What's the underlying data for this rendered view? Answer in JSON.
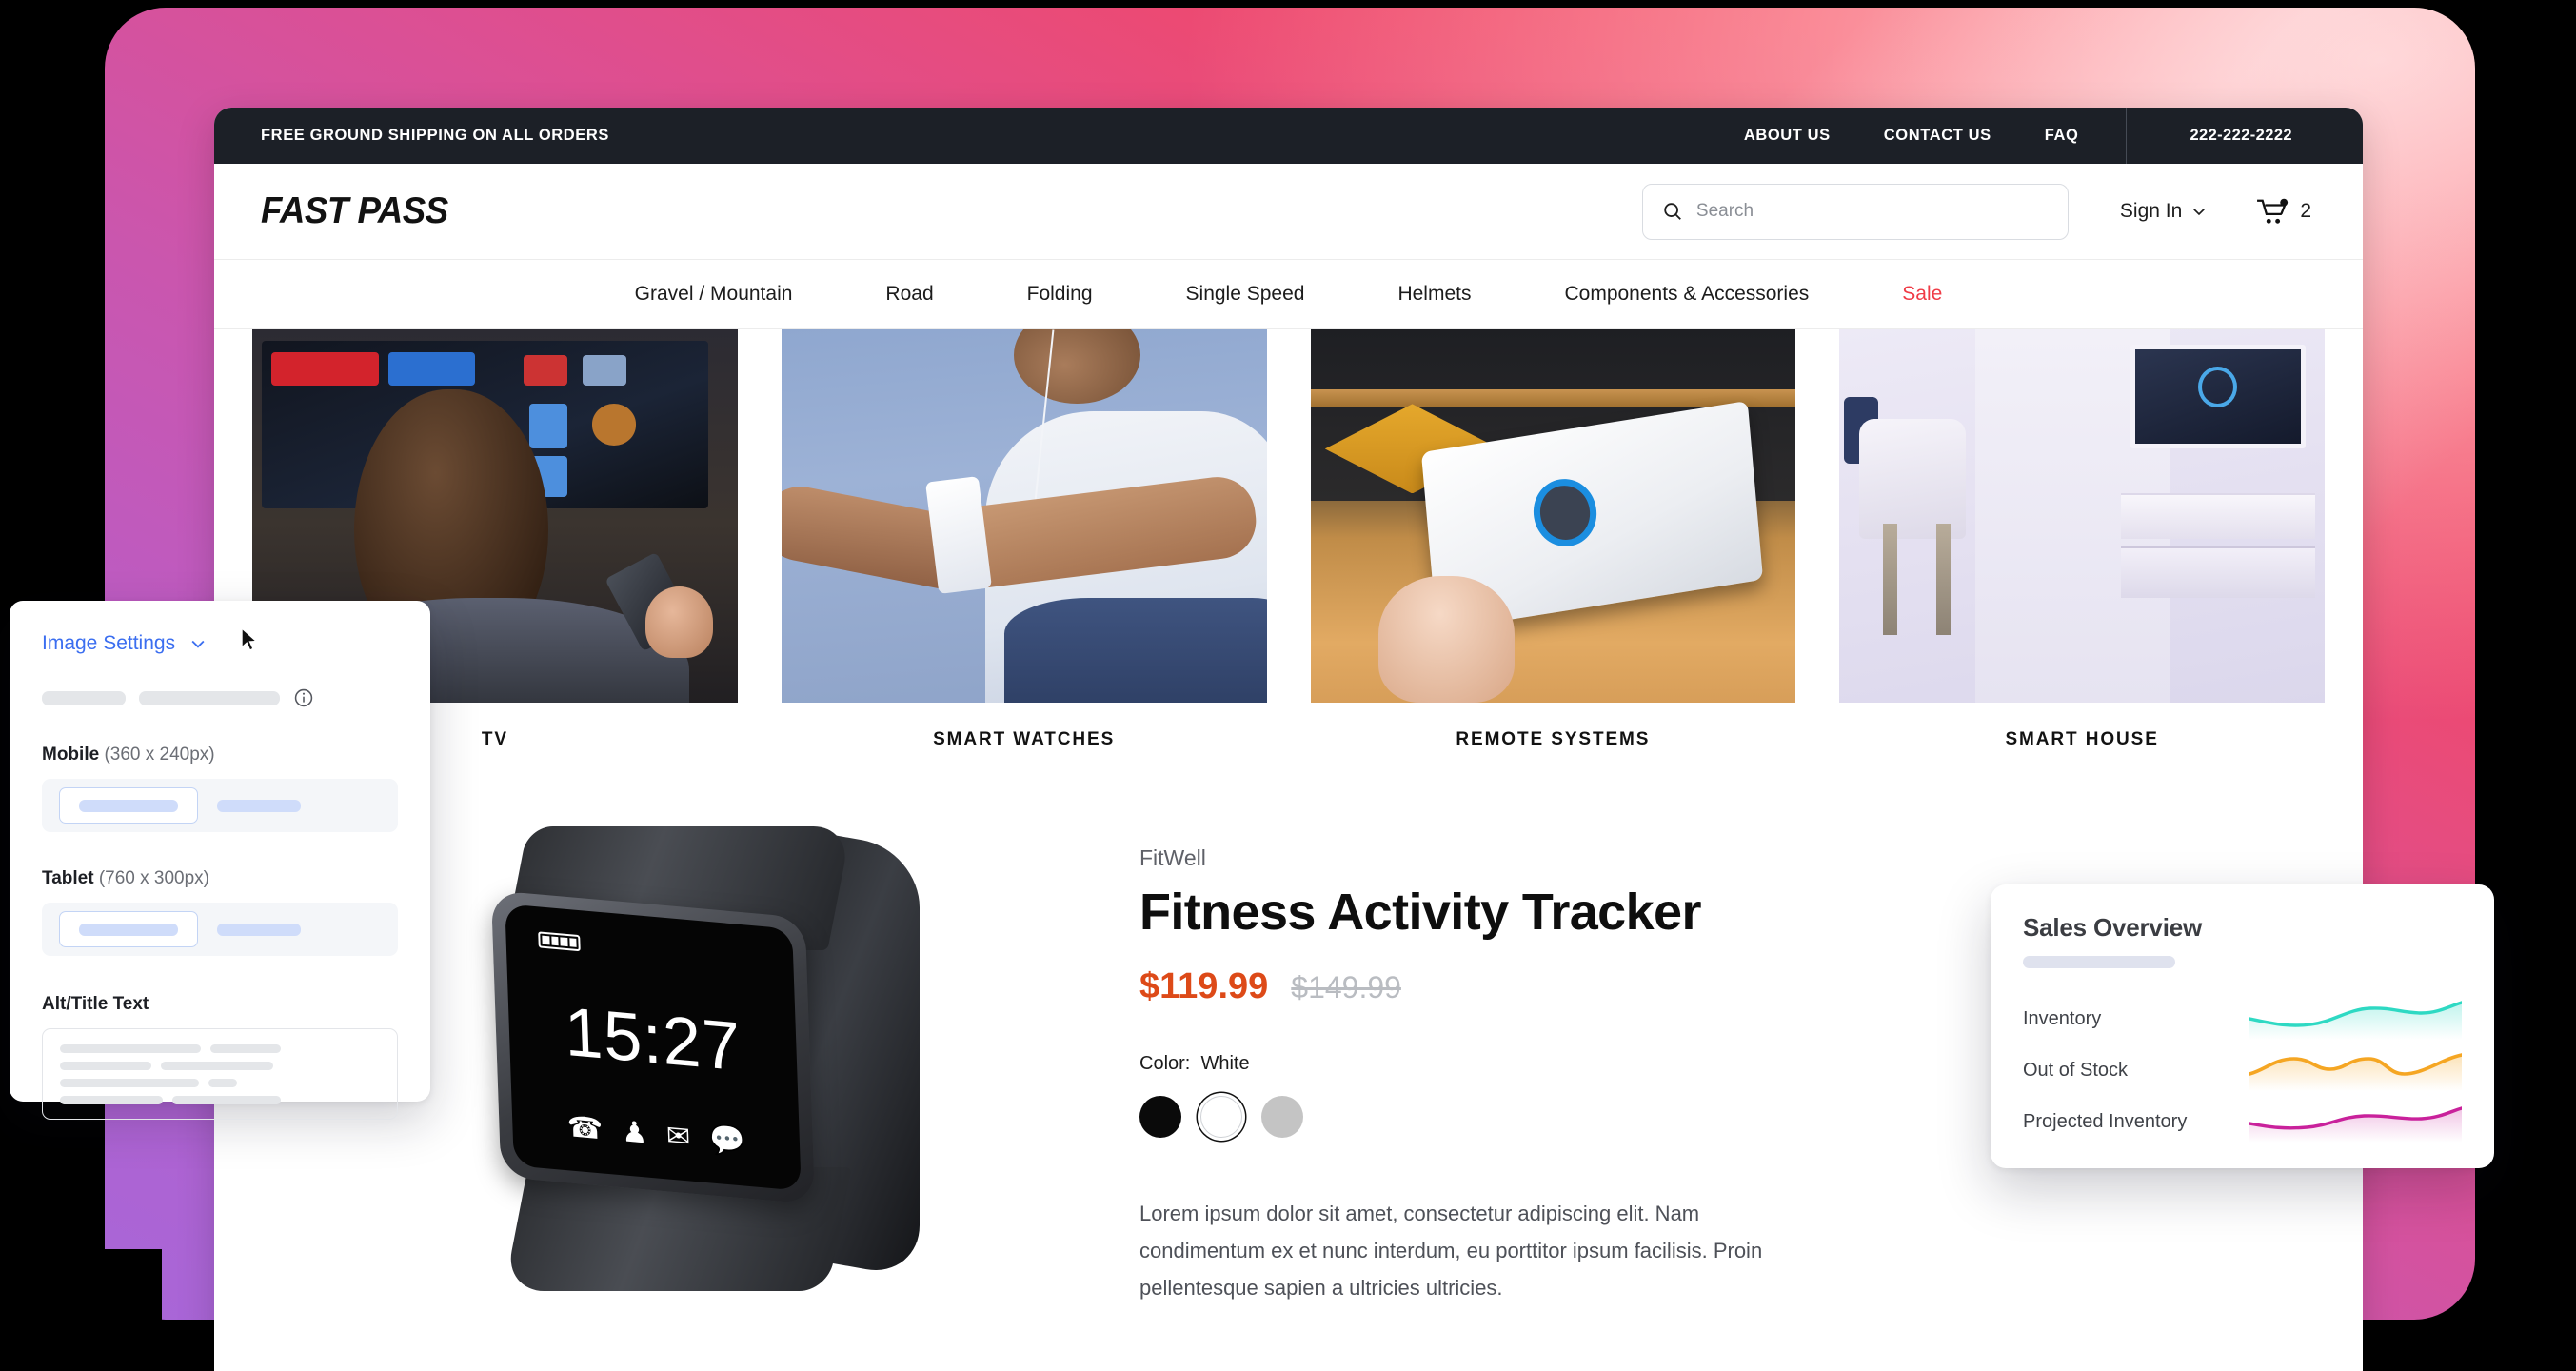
{
  "utility_bar": {
    "shipping_message": "FREE GROUND SHIPPING ON ALL ORDERS",
    "links": [
      {
        "label": "ABOUT US"
      },
      {
        "label": "CONTACT US"
      },
      {
        "label": "FAQ"
      }
    ],
    "phone": "222-222-2222"
  },
  "header": {
    "logo": "FAST PASS",
    "search": {
      "placeholder": "Search",
      "value": ""
    },
    "sign_in": "Sign In",
    "cart_count": "2"
  },
  "main_nav": {
    "items": [
      {
        "label": "Gravel / Mountain",
        "sale": false
      },
      {
        "label": "Road",
        "sale": false
      },
      {
        "label": "Folding",
        "sale": false
      },
      {
        "label": "Single Speed",
        "sale": false
      },
      {
        "label": "Helmets",
        "sale": false
      },
      {
        "label": "Components & Accessories",
        "sale": false
      },
      {
        "label": "Sale",
        "sale": true
      }
    ],
    "sale_color": "#f03b46"
  },
  "categories": [
    {
      "label": "TV"
    },
    {
      "label": "SMART WATCHES"
    },
    {
      "label": "REMOTE SYSTEMS"
    },
    {
      "label": "SMART HOUSE"
    }
  ],
  "product": {
    "brand": "FitWell",
    "title": "Fitness Activity Tracker",
    "price_now": "$119.99",
    "price_was": "$149.99",
    "price_color": "#dd4a18",
    "color_label": "Color:",
    "color_value": "White",
    "swatches": [
      {
        "name": "Black",
        "hex": "#0a0a0a",
        "selected": false
      },
      {
        "name": "White",
        "hex": "#ffffff",
        "selected": true
      },
      {
        "name": "Gray",
        "hex": "#c4c4c4",
        "selected": false
      }
    ],
    "description": "Lorem ipsum dolor sit amet, consectetur adipiscing elit. Nam condimentum ex et nunc interdum, eu porttitor ipsum facilisis. Proin pellentesque sapien a ultricies ultricies.",
    "watch_display": {
      "time": "15:27",
      "icons": [
        "phone-icon",
        "person-icon",
        "envelope-icon",
        "speech-bubble-icon"
      ]
    }
  },
  "image_settings_panel": {
    "title": "Image Settings",
    "title_color": "#3b6ef0",
    "mobile_label": "Mobile",
    "mobile_dims": "(360 x 240px)",
    "tablet_label": "Tablet",
    "tablet_dims": "(760 x 300px)",
    "alt_title_label": "Alt/Title Text"
  },
  "sales_overview": {
    "title": "Sales Overview",
    "rows": [
      {
        "label": "Inventory",
        "color": "#2ed9c3"
      },
      {
        "label": "Out of Stock",
        "color": "#f5a623"
      },
      {
        "label": "Projected Inventory",
        "color": "#c9219b"
      }
    ]
  },
  "chart_data": {
    "type": "line",
    "title": "Sales Overview",
    "xlabel": "",
    "ylabel": "",
    "grid": false,
    "legend_position": "left",
    "x": [
      0,
      1,
      2,
      3,
      4,
      5,
      6,
      7,
      8
    ],
    "series": [
      {
        "name": "Inventory",
        "color": "#2ed9c3",
        "values": [
          58,
          52,
          48,
          52,
          64,
          70,
          66,
          62,
          78
        ]
      },
      {
        "name": "Out of Stock",
        "color": "#f5a623",
        "values": [
          44,
          58,
          70,
          66,
          56,
          68,
          74,
          52,
          72
        ]
      },
      {
        "name": "Projected Inventory",
        "color": "#c9219b",
        "values": [
          48,
          44,
          46,
          54,
          64,
          66,
          62,
          66,
          76
        ]
      }
    ]
  }
}
